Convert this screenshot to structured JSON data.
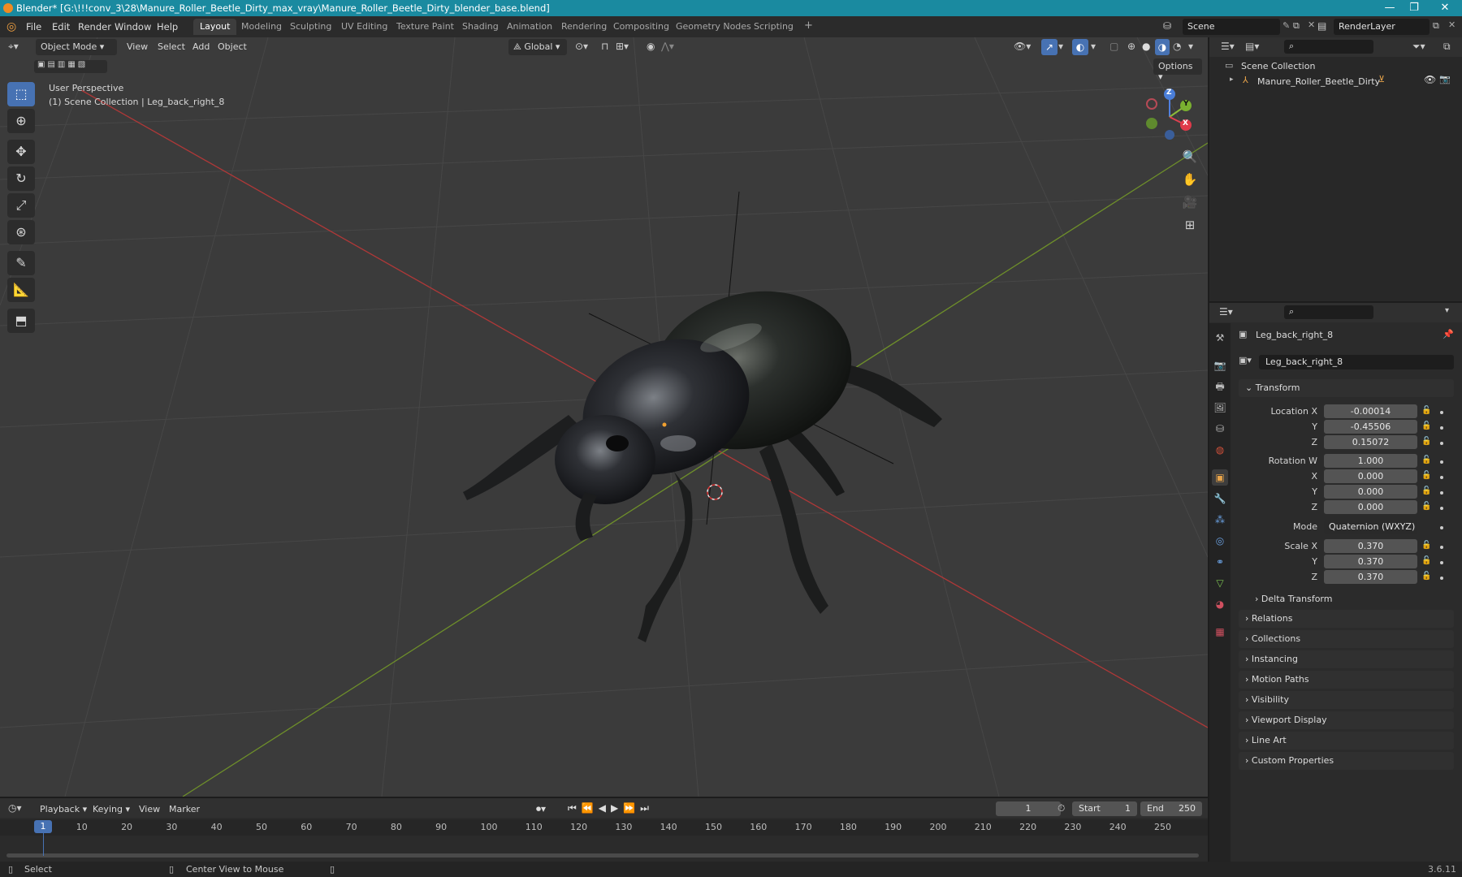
{
  "window": {
    "title": "Blender* [G:\\!!!conv_3\\28\\Manure_Roller_Beetle_Dirty_max_vray\\Manure_Roller_Beetle_Dirty_blender_base.blend]",
    "minimize": "—",
    "maximize": "❐",
    "close": "✕"
  },
  "menu": {
    "items": [
      "File",
      "Edit",
      "Render",
      "Window",
      "Help"
    ],
    "workspaces": [
      "Layout",
      "Modeling",
      "Sculpting",
      "UV Editing",
      "Texture Paint",
      "Shading",
      "Animation",
      "Rendering",
      "Compositing",
      "Geometry Nodes",
      "Scripting"
    ],
    "add_tab": "+",
    "scene": "Scene",
    "view_layer": "RenderLayer"
  },
  "viewport": {
    "mode": "Object Mode",
    "menus": [
      "View",
      "Select",
      "Add",
      "Object"
    ],
    "orientation": "Global",
    "options": "Options",
    "perspective_label": "User Perspective",
    "collection_label": "(1) Scene Collection | Leg_back_right_8",
    "gizmo": {
      "z": "Z",
      "y": "Y",
      "x": "X"
    }
  },
  "outliner": {
    "root": "Scene Collection",
    "items": [
      {
        "name": "Manure_Roller_Beetle_Dirty"
      }
    ]
  },
  "properties": {
    "object_name": "Leg_back_right_8",
    "data_name": "Leg_back_right_8",
    "transform_header": "Transform",
    "location": {
      "label": "Location X",
      "x": "-0.00014",
      "y": "-0.45506",
      "z": "0.15072"
    },
    "rotation": {
      "label": "Rotation W",
      "w": "1.000",
      "x": "0.000",
      "y": "0.000",
      "z": "0.000"
    },
    "mode_label": "Mode",
    "mode_value": "Quaternion (WXYZ)",
    "scale": {
      "label": "Scale X",
      "x": "0.370",
      "y": "0.370",
      "z": "0.370"
    },
    "axis_y": "Y",
    "axis_z": "Z",
    "axis_x": "X",
    "delta": "Delta Transform",
    "panels": [
      "Relations",
      "Collections",
      "Instancing",
      "Motion Paths",
      "Visibility",
      "Viewport Display",
      "Line Art",
      "Custom Properties"
    ]
  },
  "timeline": {
    "menus": [
      "Playback",
      "Keying",
      "View",
      "Marker"
    ],
    "current_frame": "1",
    "start_label": "Start",
    "start": "1",
    "end_label": "End",
    "end": "250",
    "ticks": [
      "1",
      "10",
      "20",
      "30",
      "40",
      "50",
      "60",
      "70",
      "80",
      "90",
      "100",
      "110",
      "120",
      "130",
      "140",
      "150",
      "160",
      "170",
      "180",
      "190",
      "200",
      "210",
      "220",
      "230",
      "240",
      "250"
    ]
  },
  "status": {
    "select": "Select",
    "center_view": "Center View to Mouse",
    "version": "3.6.11"
  }
}
